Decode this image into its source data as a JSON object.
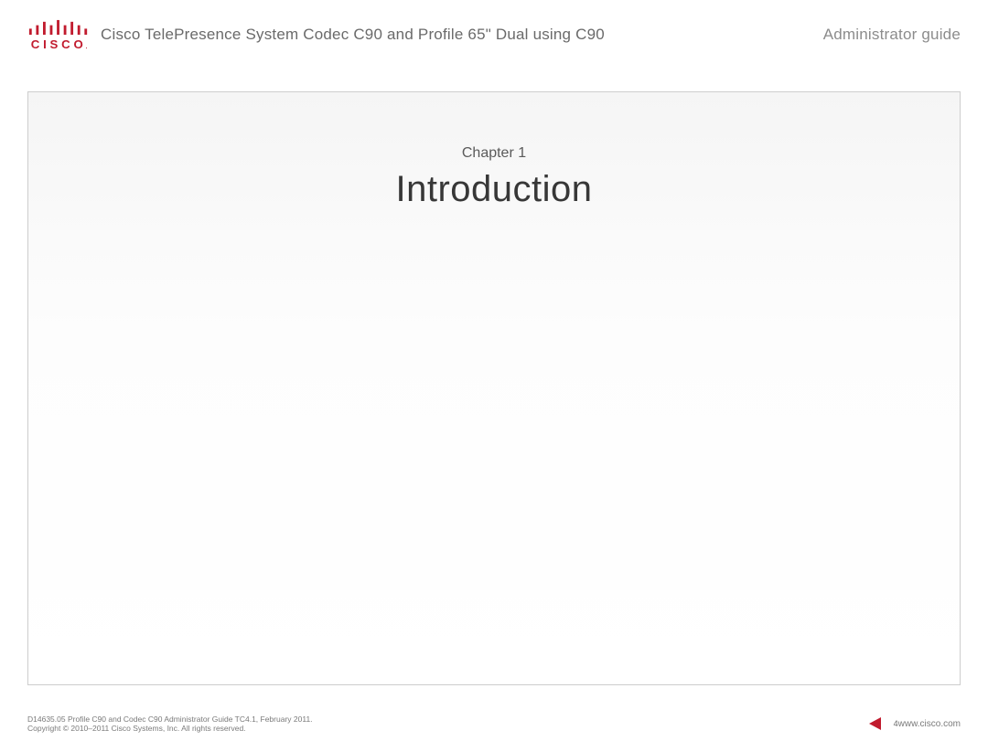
{
  "header": {
    "doc_title": "Cisco TelePresence System Codec C90 and Profile 65\" Dual using C90",
    "doc_type": "Administrator guide"
  },
  "brand": {
    "logo_color": "#c11b2e",
    "logo_text": "CISCO."
  },
  "chapter": {
    "label": "Chapter 1",
    "title": "Introduction"
  },
  "footer": {
    "line1": "D14635.05 Profile C90 and Codec C90 Administrator Guide TC4.1, February 2011.",
    "line2": "Copyright © 2010–2011 Cisco Systems, Inc. All rights reserved.",
    "page_number": "4",
    "url": "www.cisco.com"
  }
}
